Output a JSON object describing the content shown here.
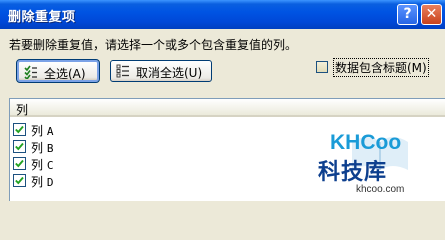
{
  "window": {
    "title": "删除重复项"
  },
  "titlebar": {
    "help_glyph": "?",
    "close_glyph": "✕"
  },
  "instruction": "若要删除重复值，请选择一个或多个包含重复值的列。",
  "buttons": {
    "select_all": "全选(A)",
    "unselect_all": "取消全选(U)"
  },
  "header_option": {
    "label": "数据包含标题(M)",
    "checked": false
  },
  "list": {
    "header": "列",
    "items": [
      {
        "prefix": "列",
        "letter": "A",
        "checked": true
      },
      {
        "prefix": "列",
        "letter": "B",
        "checked": true
      },
      {
        "prefix": "列",
        "letter": "C",
        "checked": true
      },
      {
        "prefix": "列",
        "letter": "D",
        "checked": true
      }
    ]
  },
  "watermark": {
    "brand": "KHCoo",
    "brand_cn": "科技库",
    "url": "khcoo.com"
  },
  "colors": {
    "title_bar": "#0054e3",
    "check": "#21a121",
    "brand": "#1a9bd7",
    "brand_cn": "#0d3f8e"
  }
}
